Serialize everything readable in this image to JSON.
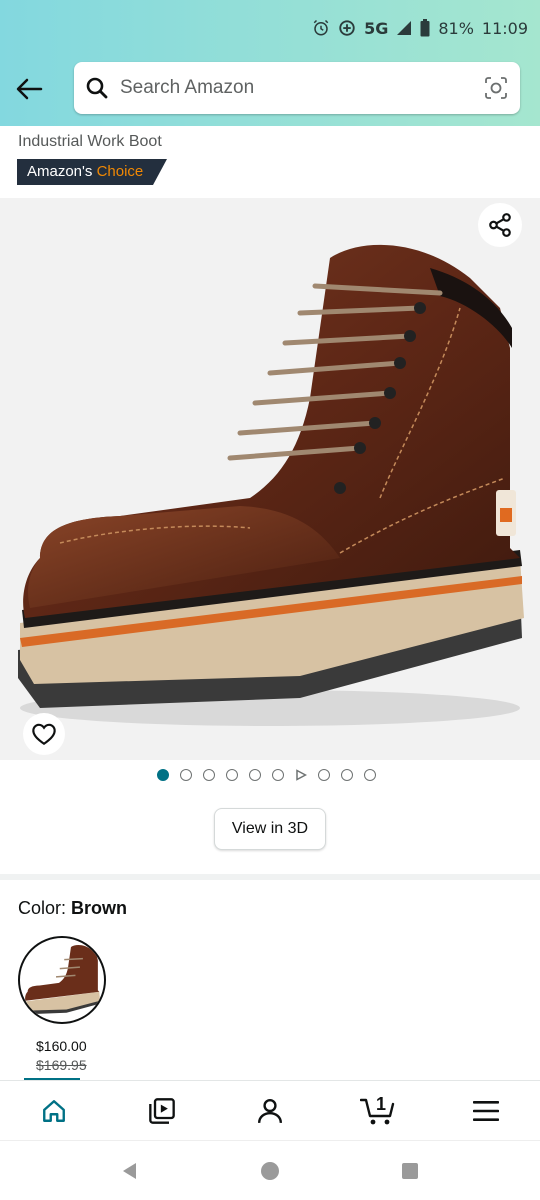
{
  "status_bar": {
    "network": "5G",
    "battery": "81%",
    "time": "11:09"
  },
  "search": {
    "placeholder": "Search Amazon"
  },
  "product": {
    "title_line": "Industrial Work Boot",
    "badge": {
      "prefix": "Amazon's",
      "highlight": "Choice"
    }
  },
  "gallery": {
    "dot_count": 10,
    "active_index": 0,
    "video_index": 6,
    "view_3d_label": "View in 3D"
  },
  "variant": {
    "label": "Color:",
    "value": "Brown",
    "price": "$160.00",
    "list_price": "$169.95"
  },
  "bottom_nav": {
    "items": [
      "home-icon",
      "video-icon",
      "account-icon",
      "cart-icon",
      "menu-icon"
    ],
    "cart_count": "1"
  },
  "colors": {
    "accent": "#007185",
    "badge_bg": "#232f3e",
    "badge_choice": "#f08804"
  }
}
